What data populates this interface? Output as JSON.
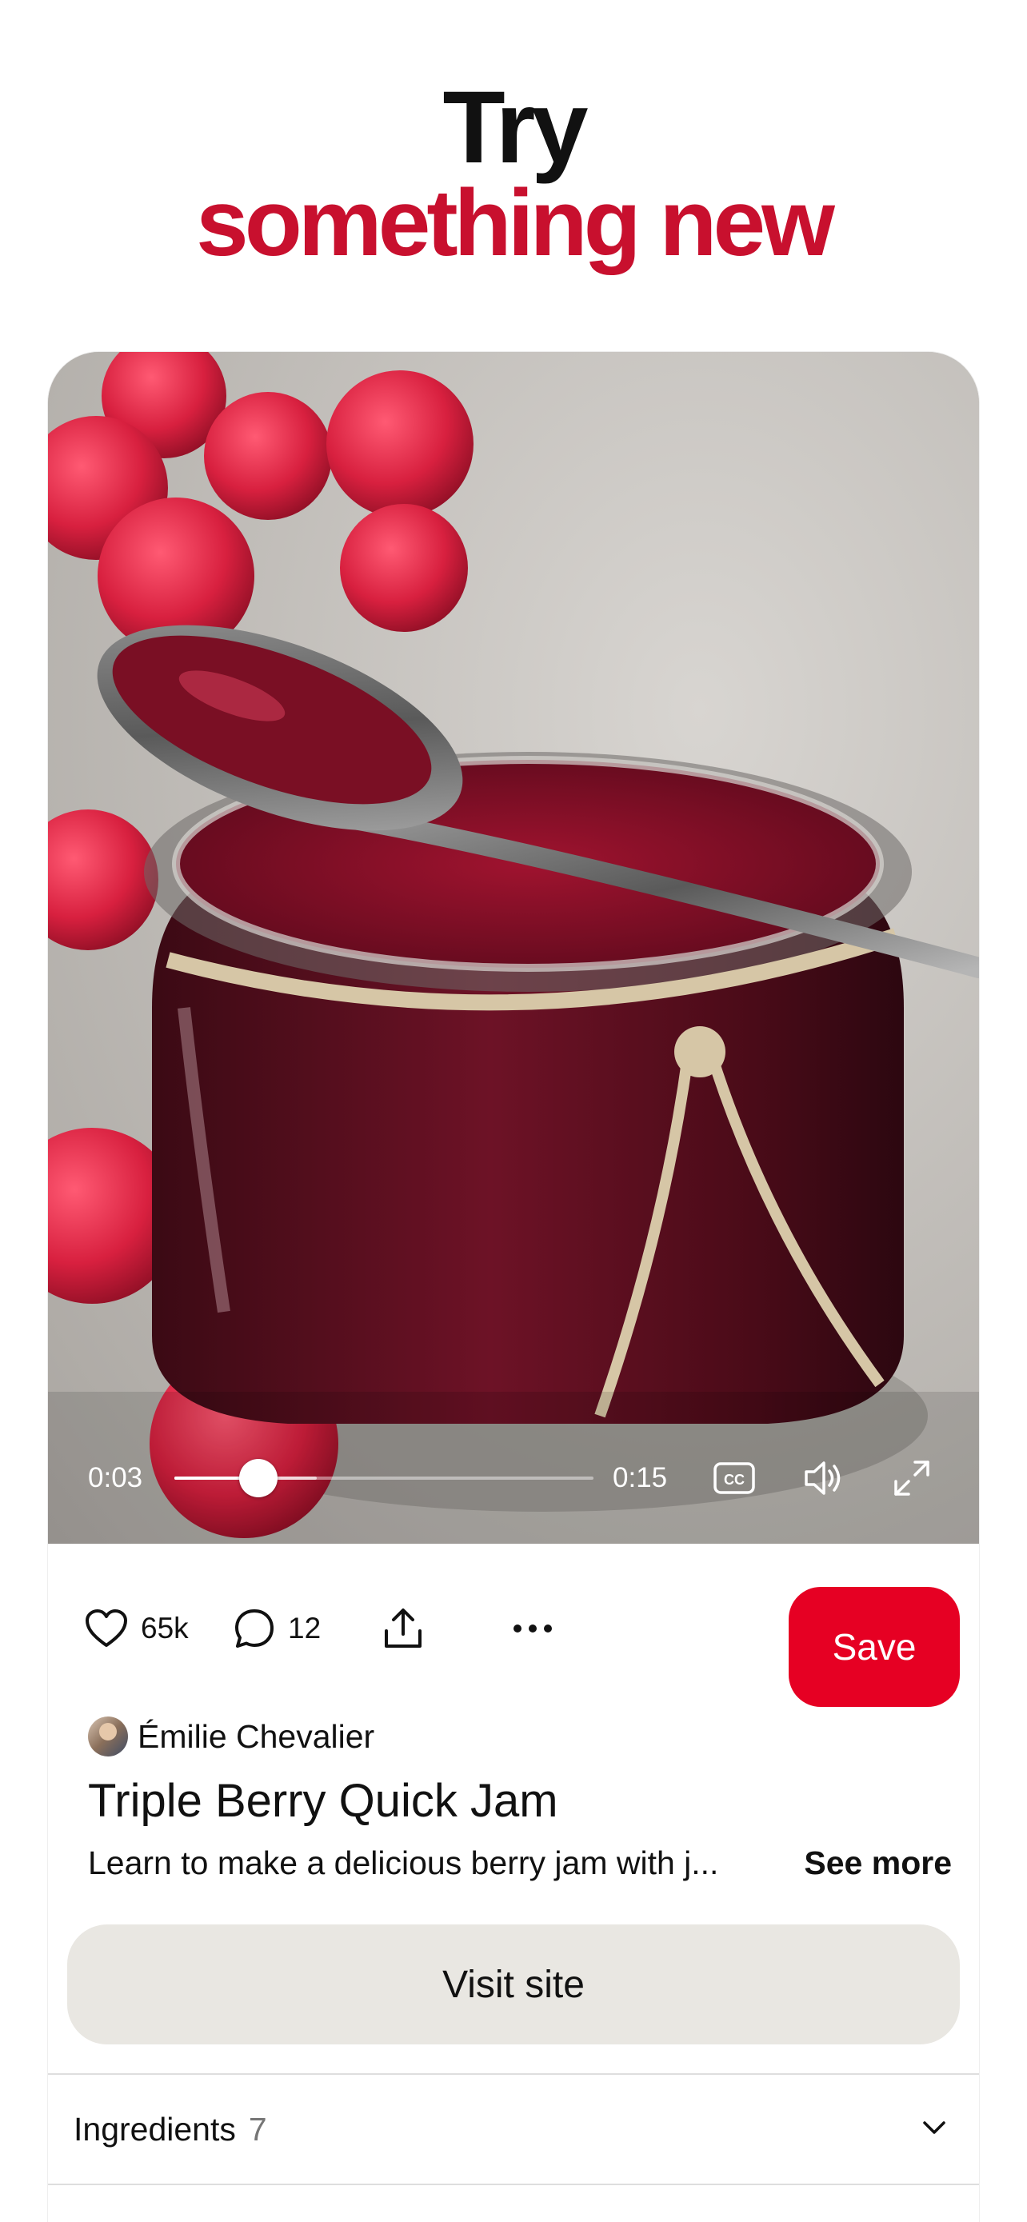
{
  "header": {
    "line1": "Try",
    "line2": "something new"
  },
  "video": {
    "current_time": "0:03",
    "duration": "0:15",
    "progress": 0.2,
    "buffered": 0.34,
    "cc_icon": "cc-icon",
    "volume_icon": "volume-icon",
    "fullscreen_icon": "expand-icon"
  },
  "actions": {
    "likes": "65k",
    "comments": "12",
    "save_label": "Save"
  },
  "pin": {
    "author": "Émilie Chevalier",
    "title": "Triple Berry Quick Jam",
    "description": "Learn to make a delicious berry jam with j...",
    "see_more": "See more",
    "visit_label": "Visit site"
  },
  "ingredients": {
    "label": "Ingredients",
    "count": "7"
  },
  "colors": {
    "brand_red": "#e60023",
    "headline_red": "#c8102e",
    "visit_bg": "#e9e7e2"
  }
}
